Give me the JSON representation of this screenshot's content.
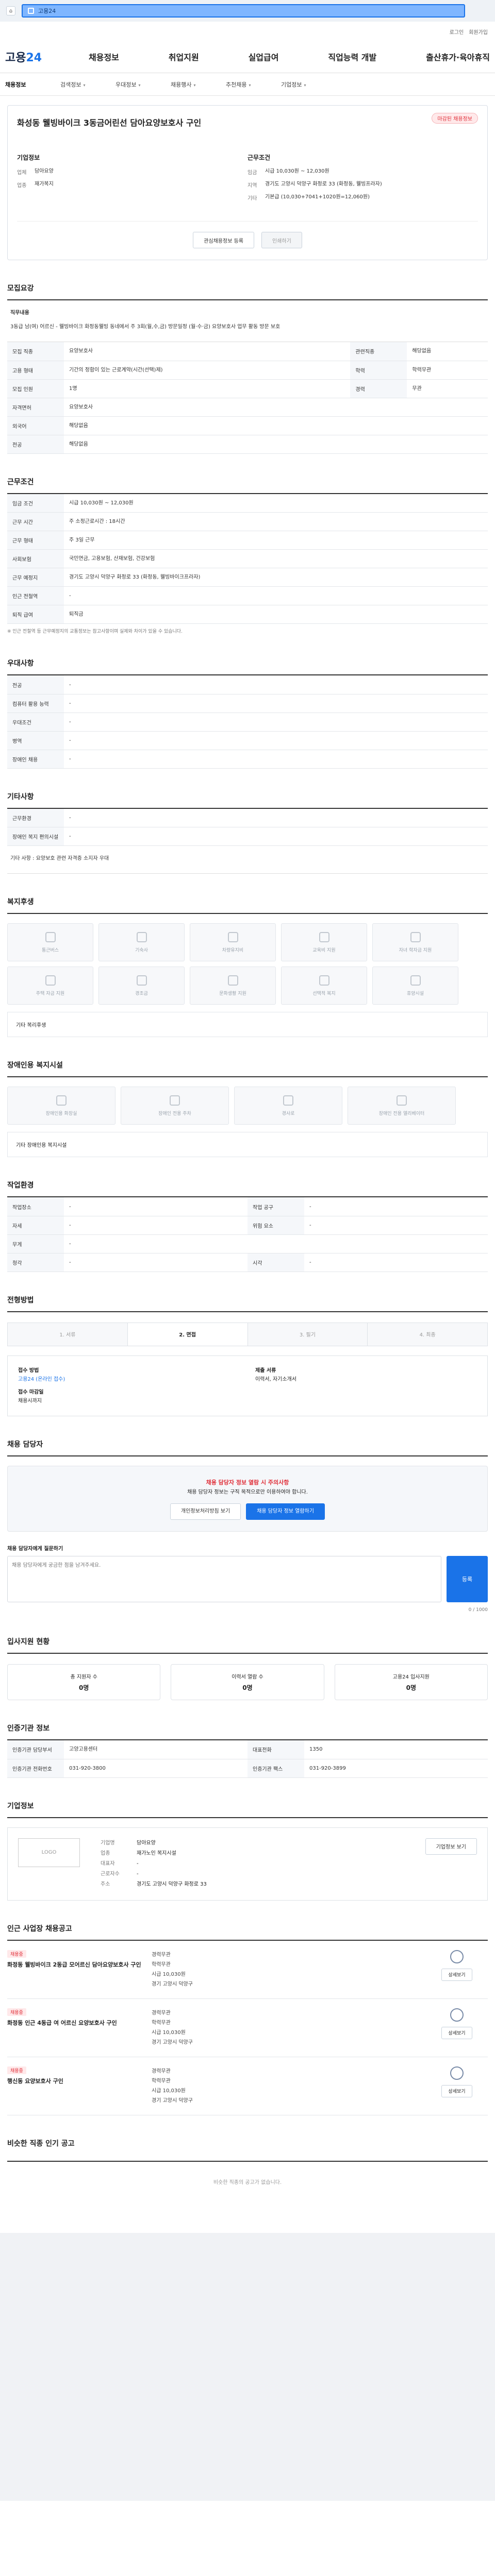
{
  "topbar": {
    "search_text": "고용24"
  },
  "header": {
    "util": [
      "로그인",
      "회원가입"
    ],
    "logo_left": "고용",
    "logo_right": "24",
    "gnb": [
      "채용정보",
      "취업지원",
      "실업급여",
      "직업능력 개발",
      "출산휴가·육아휴직"
    ]
  },
  "subnav": [
    "채용정보",
    "검색정보",
    "우대정보",
    "채용행사",
    "추천채용",
    "기업정보"
  ],
  "job": {
    "status": "마감된 채용정보",
    "title": "화성동 웰빙바이크 3동금어린선 담아요양보호사 구인",
    "company_title": "기업정보",
    "company": [
      [
        "업체",
        "담아요양"
      ],
      [
        "업종",
        "재가복지"
      ]
    ],
    "conditions_title": "근무조건",
    "conditions": [
      [
        "임금",
        "시급 10,030원 ~ 12,030원"
      ],
      [
        "지역",
        "경기도 고양시 덕양구 화정로 33 (화정동, 웰빙프라자)"
      ],
      [
        "기타",
        "기본급 (10,030+7041+1020원=12,060원)"
      ]
    ],
    "btn_scrap": "관심채용정보 등록",
    "btn_apply": "인쇄하기"
  },
  "sections": {
    "recruit": "모집요강",
    "duty_title": "직무내용",
    "duty_text": "3동급 남(여) 어르신 - 웰빙바이크 화정동웰빙 동네에서 주 3회(월,수,금) 방문일정 (월·수·금) 요양보호사 업무 활동 방문 보호",
    "conditions2": "근무조건",
    "pref": "우대사항",
    "other": "기타사항",
    "welfare": "복지후생",
    "disabled_welfare": "장애인용 복지시설",
    "env": "작업환경",
    "process": "전형방법",
    "contact": "채용 담당자",
    "stats": "입사지원 현황",
    "contact_info": "인증기관 정보",
    "company_info": "기업정보",
    "others": "인근 사업장 채용공고",
    "similar": "비슷한 직종 인기 공고"
  },
  "recruit_rows": [
    [
      "모집 직종",
      "요양보호사",
      "관련직종",
      "해당없음"
    ],
    [
      "고용 형태",
      "기간의 정함이 있는 근로계약(시간(선택)제)",
      "학력",
      "학력무관"
    ],
    [
      "모집 인원",
      "1명",
      "경력",
      "무관"
    ],
    [
      "자격면허",
      "요양보호사",
      "",
      ""
    ],
    [
      "외국어",
      "해당없음",
      "",
      ""
    ],
    [
      "전공",
      "해당없음",
      "",
      ""
    ]
  ],
  "cond_rows": [
    [
      "임금 조건",
      "시급 10,030원 ~ 12,030원"
    ],
    [
      "근무 시간",
      "주 소정근로시간 : 18시간"
    ],
    [
      "근무 형태",
      "주 3일 근무"
    ],
    [
      "사회보험",
      "국민연금, 고용보험, 산재보험, 건강보험"
    ],
    [
      "근무 예정지",
      "경기도 고양시 덕양구 화정로 33 (화정동, 웰빙바이크프라자)"
    ],
    [
      "인근 전철역",
      "-"
    ],
    [
      "퇴직 급여",
      "퇴직금"
    ]
  ],
  "cond_note": "※ 인근 전철역 등 근무예정지의 교통정보는 참고사항이며 실제와 차이가 있을 수 있습니다.",
  "pref_rows": [
    [
      "전공",
      "-"
    ],
    [
      "컴퓨터 활용 능력",
      "-"
    ],
    [
      "우대조건",
      "-"
    ],
    [
      "병역",
      "-"
    ],
    [
      "장애인 채용",
      "-"
    ]
  ],
  "other_rows": [
    [
      "근무환경",
      "-"
    ],
    [
      "장애인 복지 편의시설",
      "-"
    ]
  ],
  "other_text": "기타 사항 : 요양보호 관련 자격증 소지자 우대",
  "welfare": [
    "통근버스",
    "기숙사",
    "차량유지비",
    "교육비 지원",
    "자녀 학자금 지원",
    "주택 자금 지원",
    "경조금",
    "문화생활 지원",
    "선택적 복지",
    "휴양시설"
  ],
  "welfare_other": "기타 복리후생",
  "disabled_facilities": [
    "장애인용 화장실",
    "장애인 전용 주차",
    "경사로",
    "장애인 전용 엘리베이터"
  ],
  "disabled_other": "기타 장애인용 복지시설",
  "env_rows": [
    [
      "작업장소",
      "-",
      "작업 공구",
      "-"
    ],
    [
      "자세",
      "-",
      "위험 요소",
      "-"
    ],
    [
      "무게",
      "-",
      "",
      ""
    ],
    [
      "청각",
      "-",
      "시각",
      "-"
    ]
  ],
  "steps": [
    "1. 서류",
    "2. 면접",
    "3. 필기",
    "4. 최종"
  ],
  "apply": {
    "method_t": "접수 방법",
    "method": "고용24 (온라인 접수)",
    "deadline_t": "접수 마감일",
    "deadline": "채용시까지",
    "docs_t": "제출 서류",
    "docs": "이력서, 자기소개서"
  },
  "notice": {
    "t1": "채용 담당자 정보 열람 시 주의사항",
    "t2": "채용 담당자 정보는 구직 목적으로만 이용하여야 합니다.",
    "btn1": "개인정보처리방침 보기",
    "btn2": "채용 담당자 정보 열람하기"
  },
  "inquiry": {
    "label": "채용 담당자에게 질문하기",
    "placeholder": "채용 담당자에게 궁금한 점을 남겨주세요.",
    "count": "0 / 1000",
    "btn": "등록"
  },
  "stats_items": [
    [
      "총 지원자 수",
      "0명"
    ],
    [
      "이력서 열람 수",
      "0명"
    ],
    [
      "고용24 입사지원",
      "0명"
    ]
  ],
  "contact_rows": [
    [
      "인증기관 담당부서",
      "고양고용센터",
      "대표전화",
      "1350"
    ],
    [
      "인증기관 전화번호",
      "031-920-3800",
      "인증기관 팩스",
      "031-920-3899"
    ]
  ],
  "company_rows": [
    [
      "기업명",
      "담아요양"
    ],
    [
      "업종",
      "재가노인 복지시설"
    ],
    [
      "대표자",
      "-"
    ],
    [
      "근로자수",
      "-"
    ],
    [
      "주소",
      "경기도 고양시 덕양구 화정로 33"
    ]
  ],
  "company_btn": "기업정보 보기",
  "others_items": [
    {
      "badge": "채용중",
      "title": "화정동 웰빙바이크 2동급 모어르신 담아요양보호사 구인",
      "meta": [
        "경력무관",
        "학력무관",
        "시급 10,030원",
        "경기 고양시 덕양구"
      ],
      "btn": "상세보기"
    },
    {
      "badge": "채용중",
      "title": "화정동 인근 4동급 여 어르신 요양보호사 구인",
      "meta": [
        "경력무관",
        "학력무관",
        "시급 10,030원",
        "경기 고양시 덕양구"
      ],
      "btn": "상세보기"
    },
    {
      "badge": "채용중",
      "title": "행신동 요양보호사 구인",
      "meta": [
        "경력무관",
        "학력무관",
        "시급 10,030원",
        "경기 고양시 덕양구"
      ],
      "btn": "상세보기"
    }
  ],
  "similar_empty": "비슷한 직종의 공고가 없습니다."
}
